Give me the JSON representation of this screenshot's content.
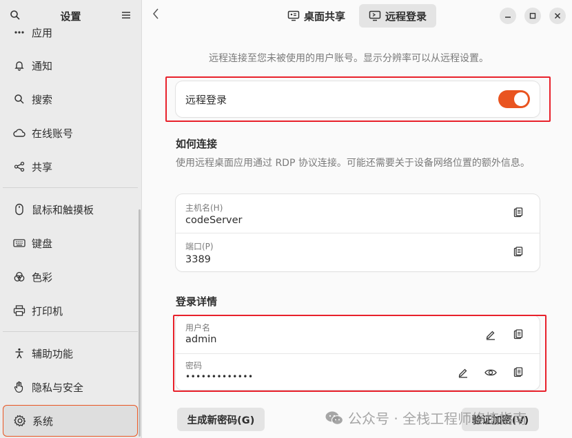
{
  "sidebar": {
    "title": "设置",
    "items": [
      {
        "label": "应用"
      },
      {
        "label": "通知"
      },
      {
        "label": "搜索"
      },
      {
        "label": "在线账号"
      },
      {
        "label": "共享"
      },
      {
        "label": "鼠标和触摸板"
      },
      {
        "label": "键盘"
      },
      {
        "label": "色彩"
      },
      {
        "label": "打印机"
      },
      {
        "label": "辅助功能"
      },
      {
        "label": "隐私与安全"
      },
      {
        "label": "系统"
      }
    ]
  },
  "header": {
    "tabs": [
      {
        "label": "桌面共享"
      },
      {
        "label": "远程登录"
      }
    ]
  },
  "content": {
    "intro": "远程连接至您未被使用的用户账号。显示分辨率可以从远程设置。",
    "remote_login": {
      "label": "远程登录",
      "enabled": true
    },
    "how_to_connect": {
      "title": "如何连接",
      "description": "使用远程桌面应用通过 RDP 协议连接。可能还需要关于设备网络位置的额外信息。",
      "hostname_caption": "主机名(H)",
      "hostname_value": "codeServer",
      "port_caption": "端口(P)",
      "port_value": "3389"
    },
    "login_details": {
      "title": "登录详情",
      "username_caption": "用户名",
      "username_value": "admin",
      "password_caption": "密码",
      "password_value": "•••••••••••••"
    },
    "buttons": {
      "generate": "生成新密码(G)",
      "verify": "验证加密(V)"
    }
  },
  "watermark": "公众号 · 全栈工程师修炼指南",
  "colors": {
    "accent": "#e95420",
    "highlight": "#e8202a"
  }
}
